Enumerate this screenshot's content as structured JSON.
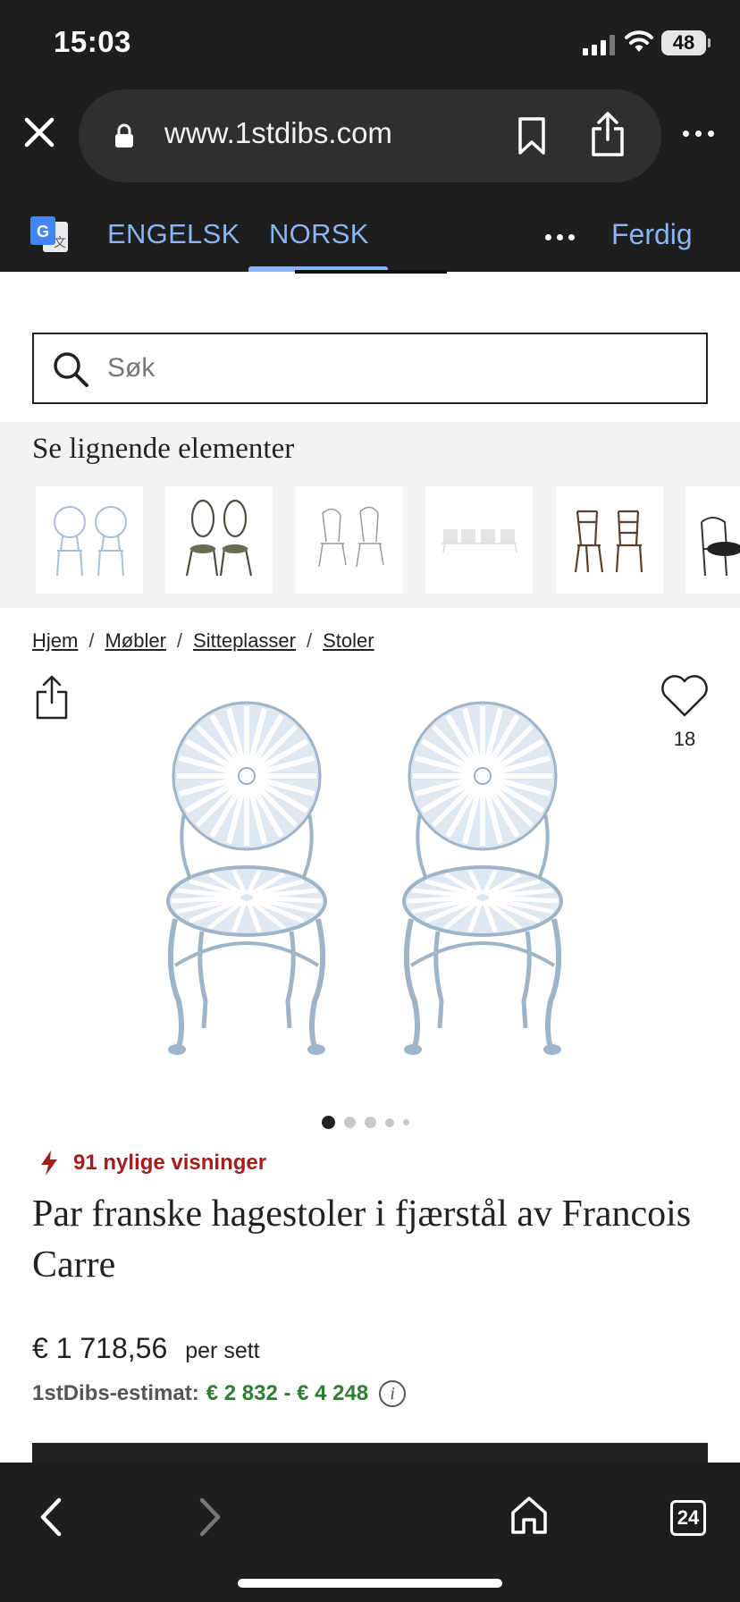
{
  "status_bar": {
    "time": "15:03",
    "battery": "48"
  },
  "browser": {
    "url": "www.1stdibs.com",
    "icons": [
      "close-icon",
      "lock-icon",
      "bookmark-icon",
      "share-icon",
      "more-icon"
    ]
  },
  "translate": {
    "source_lang": "ENGELSK",
    "target_lang": "NORSK",
    "done_label": "Ferdig",
    "accent": "#8ab4f8"
  },
  "search": {
    "placeholder": "Søk"
  },
  "similar": {
    "title": "Se lignende elementer",
    "thumbnails": [
      "sunburst-chairs-white",
      "leaf-back-chairs",
      "wire-chairs",
      "garden-chairs-set",
      "brown-folding-chairs",
      "armchair"
    ]
  },
  "breadcrumb": [
    {
      "label": "Hjem"
    },
    {
      "label": "Møbler"
    },
    {
      "label": "Sitteplasser"
    },
    {
      "label": "Stoler"
    }
  ],
  "favorite": {
    "count": "18"
  },
  "carousel": {
    "image_count": 5,
    "active_index": 0
  },
  "product": {
    "views": "91 nylige visninger",
    "title": "Par franske hagestoler i fjærstål av Francois Carre",
    "price": "€ 1 718,56",
    "price_unit": "per sett",
    "estimate_label": "1stDibs-estimat:",
    "estimate_value": "€ 2 832 - € 4 248",
    "info_icon": "i"
  },
  "colors": {
    "views_red": "#a51c1c",
    "estimate_green": "#2e7d32",
    "chrome_bg": "#1e1e1e"
  },
  "toolbar": {
    "tab_count": "24"
  }
}
